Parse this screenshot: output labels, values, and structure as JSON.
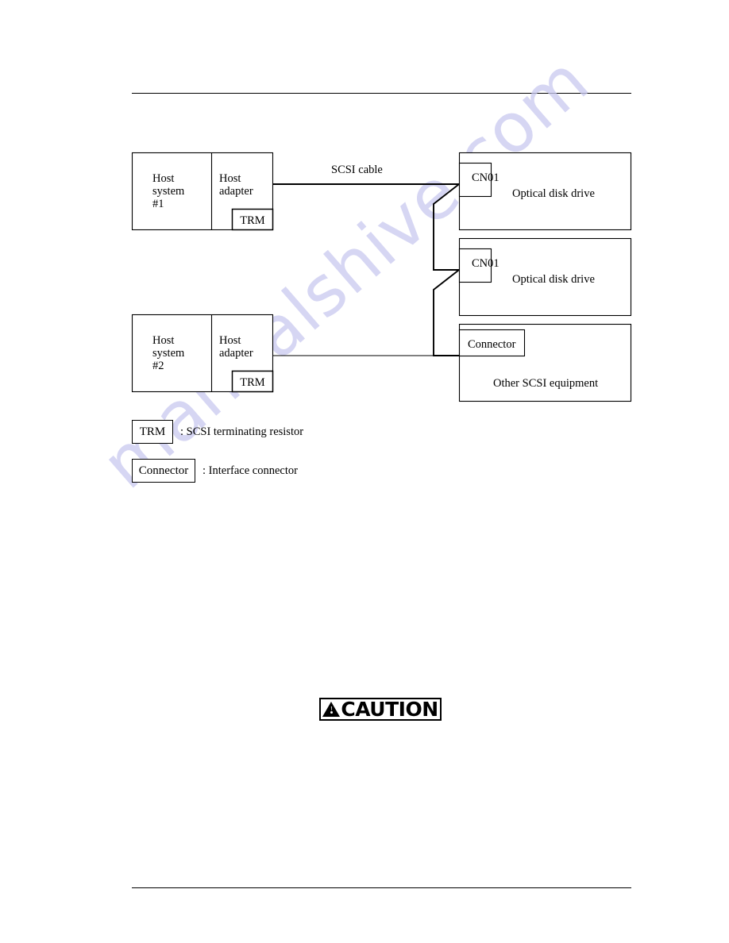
{
  "page": {
    "watermark": "manualshive.com",
    "rules": {
      "top": true,
      "bottom": true
    }
  },
  "diagram": {
    "cable_label": "SCSI cable",
    "hosts": [
      {
        "system_label_line1": "Host",
        "system_label_line2": "system",
        "system_label_line3": "#1",
        "adapter_label_line1": "Host",
        "adapter_label_line2": "adapter",
        "terminator_label": "TRM"
      },
      {
        "system_label_line1": "Host",
        "system_label_line2": "system",
        "system_label_line3": "#2",
        "adapter_label_line1": "Host",
        "adapter_label_line2": "adapter",
        "terminator_label": "TRM"
      }
    ],
    "devices": [
      {
        "connector_label": "CN01",
        "name": "Optical disk drive"
      },
      {
        "connector_label": "CN01",
        "name": "Optical disk drive"
      },
      {
        "connector_label": "Connector",
        "name": "Other SCSI equipment"
      }
    ]
  },
  "legend": [
    {
      "symbol": "TRM",
      "description": ": SCSI terminating resistor"
    },
    {
      "symbol": "Connector",
      "description": ": Interface connector"
    }
  ],
  "caution": {
    "label": "CAUTION",
    "icon": "warning-triangle-icon"
  }
}
